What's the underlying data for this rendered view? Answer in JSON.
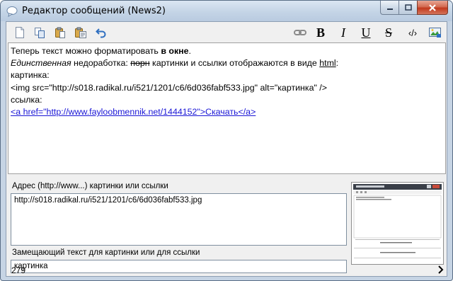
{
  "window": {
    "title": "Редактор сообщений (News2)"
  },
  "toolbar": {
    "left_icons": [
      "new-document-icon",
      "copy-icon",
      "paste-icon",
      "paste-special-icon",
      "undo-icon"
    ],
    "right_icons": [
      "link-icon",
      "bold-icon",
      "italic-icon",
      "underline-icon",
      "strikethrough-icon",
      "tag-icon",
      "insert-image-icon"
    ],
    "bold_label": "B",
    "italic_label": "I",
    "underline_label": "U",
    "strike_label": "S",
    "tag_label": "‹/›"
  },
  "editor": {
    "line1_text": "Теперь текст можно форматировать ",
    "line1_bold": "в окне",
    "line1_end": ".",
    "line2_italic": "Единственная",
    "line2_text_a": " недоработка: ",
    "line2_strike": "порн",
    "line2_text_b": " картинки и ссылки отображаются в виде ",
    "line2_underline": "html",
    "line2_end": ":",
    "line3": "картинка:",
    "line4": "<img src=\"http://s018.radikal.ru/i521/1201/c6/6d036fabf533.jpg\" alt=\"картинка\" />",
    "line5": "ссылка:",
    "line6_link": "<a href=\"http://www.fayloobmennik.net/1444152\">Скачать</a>"
  },
  "fields": {
    "url_label": "Адрес (http://www...) картинки или ссылки",
    "url_value": "http://s018.radikal.ru/i521/1201/c6/6d036fabf533.jpg",
    "alt_label": "Замещающий текст для картинки или для ссылки",
    "alt_value": "картинка"
  },
  "status": {
    "count": "279"
  },
  "colors": {
    "link": "#1a16d6",
    "window_frame": "#c6d4e4",
    "close_button": "#c2391d"
  }
}
